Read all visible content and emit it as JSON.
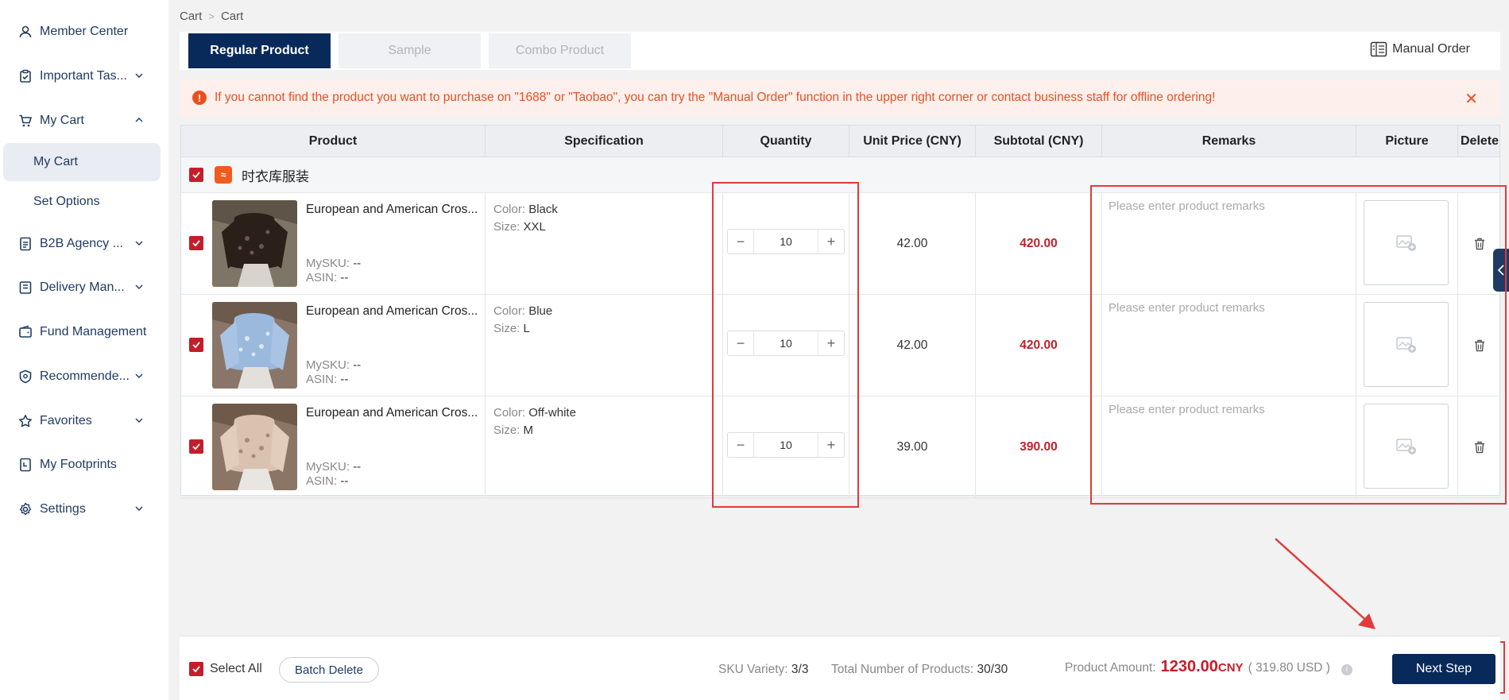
{
  "sidebar": {
    "items": [
      {
        "label": "Member Center",
        "icon": "user-icon"
      },
      {
        "label": "Important Tas...",
        "icon": "clipboard-icon"
      },
      {
        "label": "My Cart",
        "icon": "cart-icon"
      },
      {
        "label": "B2B Agency ...",
        "icon": "document-icon"
      },
      {
        "label": "Delivery Man...",
        "icon": "truck-icon"
      },
      {
        "label": "Fund Management",
        "icon": "wallet-icon"
      },
      {
        "label": "Recommende...",
        "icon": "recommend-icon"
      },
      {
        "label": "Favorites",
        "icon": "star-icon"
      },
      {
        "label": "My Footprints",
        "icon": "footprints-icon"
      },
      {
        "label": "Settings",
        "icon": "gear-icon"
      }
    ],
    "cart_sub": [
      "My Cart",
      "Set Options"
    ]
  },
  "breadcrumb": [
    "Cart",
    "Cart"
  ],
  "tabs": [
    "Regular Product",
    "Sample",
    "Combo Product"
  ],
  "manual_order_label": "Manual Order",
  "notice": "If you cannot find the product you want to purchase on \"1688\" or \"Taobao\", you can try the \"Manual Order\" function in the upper right corner or contact business staff for offline ordering!",
  "table": {
    "headers": [
      "Product",
      "Specification",
      "Quantity",
      "Unit Price (CNY)",
      "Subtotal (CNY)",
      "Remarks",
      "Picture",
      "Delete"
    ],
    "shop_name": "时衣库服装",
    "rows": [
      {
        "name": "European and American Cros...",
        "mysku_label": "MySKU:",
        "mysku": "--",
        "asin_label": "ASIN:",
        "asin": "--",
        "color_label": "Color:",
        "color": "Black",
        "size_label": "Size:",
        "size": "XXL",
        "qty": "10",
        "unit_price": "42.00",
        "subtotal": "420.00",
        "remarks_placeholder": "Please enter product remarks",
        "swatch": "#2b1f1a"
      },
      {
        "name": "European and American Cros...",
        "mysku_label": "MySKU:",
        "mysku": "--",
        "asin_label": "ASIN:",
        "asin": "--",
        "color_label": "Color:",
        "color": "Blue",
        "size_label": "Size:",
        "size": "L",
        "qty": "10",
        "unit_price": "42.00",
        "subtotal": "420.00",
        "remarks_placeholder": "Please enter product remarks",
        "swatch": "#9bb8dd"
      },
      {
        "name": "European and American Cros...",
        "mysku_label": "MySKU:",
        "mysku": "--",
        "asin_label": "ASIN:",
        "asin": "--",
        "color_label": "Color:",
        "color": "Off-white",
        "size_label": "Size:",
        "size": "M",
        "qty": "10",
        "unit_price": "39.00",
        "subtotal": "390.00",
        "remarks_placeholder": "Please enter product remarks",
        "swatch": "#c8a994"
      }
    ]
  },
  "footer": {
    "select_all": "Select All",
    "batch_delete": "Batch Delete",
    "sku_label": "SKU Variety:",
    "sku_value": "3/3",
    "total_label": "Total Number of Products:",
    "total_value": "30/30",
    "amount_label": "Product Amount:",
    "amount_value": "1230.00",
    "amount_unit": "CNY",
    "usd": "( 319.80 USD )",
    "next_step": "Next Step"
  },
  "colors": {
    "primary": "#082a5a",
    "accent_red": "#c41e2a",
    "notice_orange": "#e8501f",
    "highlight": "#e03b3b"
  }
}
